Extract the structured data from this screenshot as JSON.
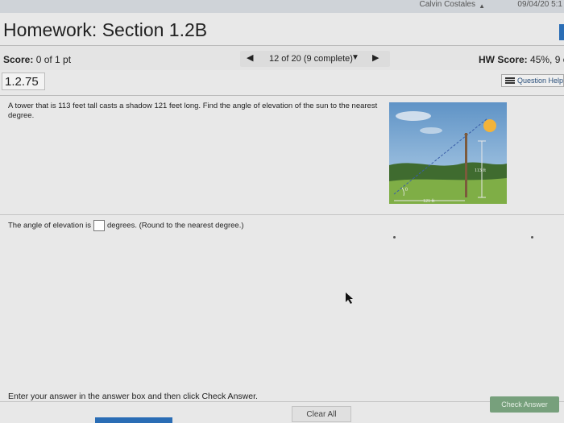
{
  "topbar": {
    "user": "Calvin Costales",
    "time": "09/04/20 5:1"
  },
  "header": {
    "title": "Homework: Section 1.2B"
  },
  "score": {
    "label": "Score:",
    "value": "0 of 1 pt"
  },
  "nav": {
    "progress": "12 of 20 (9 complete)"
  },
  "hw_score": {
    "label": "HW Score:",
    "value": "45%, 9 o"
  },
  "question": {
    "number": "1.2.75",
    "help_label": "Question Help",
    "text": "A tower that is 113 feet tall casts a shadow 121 feet long. Find the angle of elevation of the sun to the nearest degree."
  },
  "figure": {
    "height_label": "113 ft",
    "shadow_label": "121 ft",
    "angle_label": "θ"
  },
  "answer": {
    "prefix": "The angle of elevation is",
    "suffix": "degrees. (Round to the nearest degree.)"
  },
  "footer": {
    "instruction": "Enter your answer in the answer box and then click Check Answer.",
    "clear_label": "Clear All",
    "check_label": "Check Answer"
  },
  "colors": {
    "accent": "#2a6db5",
    "check_button": "#77a07c"
  },
  "icons": [
    "prev-arrow-icon",
    "dropdown-arrow-icon",
    "next-arrow-icon",
    "list-icon",
    "sun-icon",
    "mouse-cursor-icon"
  ]
}
